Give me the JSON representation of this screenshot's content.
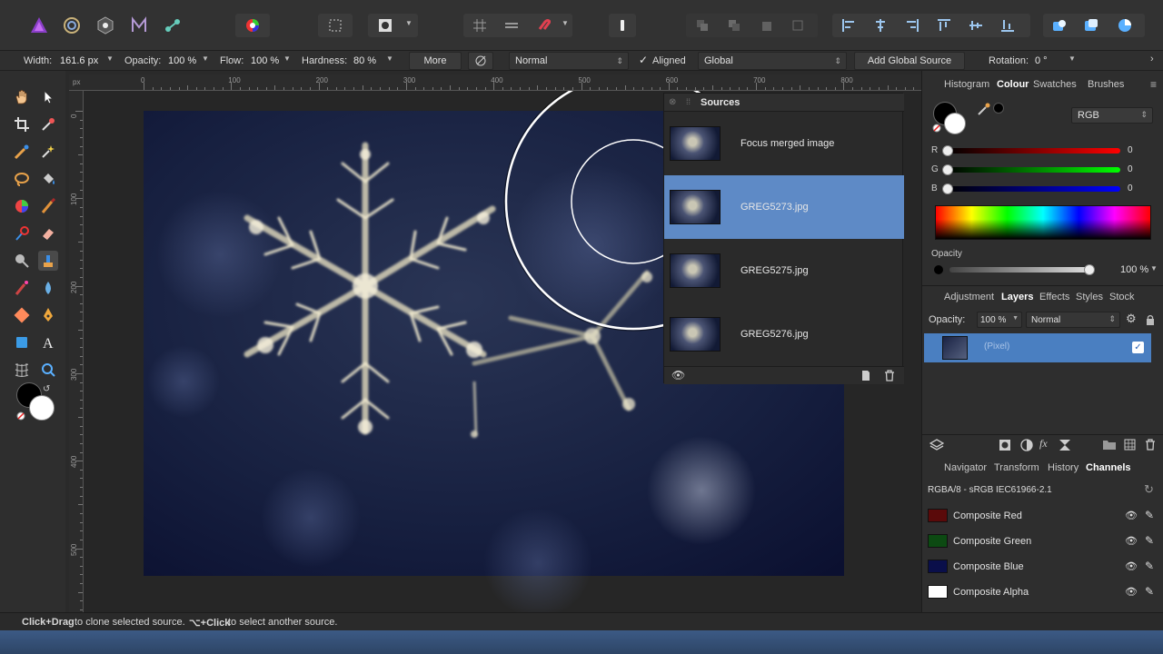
{
  "context_bar": {
    "width_label": "Width:",
    "width_value": "161.6 px",
    "opacity_label": "Opacity:",
    "opacity_value": "100 %",
    "flow_label": "Flow:",
    "flow_value": "100 %",
    "hardness_label": "Hardness:",
    "hardness_value": "80 %",
    "more_label": "More",
    "blend_mode": "Normal",
    "aligned_label": "Aligned",
    "aligned_checked": true,
    "source_mode": "Global",
    "add_source_label": "Add Global Source",
    "rotation_label": "Rotation:",
    "rotation_value": "0 °"
  },
  "rulers": {
    "unit": "px",
    "h_ticks": [
      "0",
      "100",
      "200",
      "300",
      "400",
      "500",
      "600",
      "700",
      "800"
    ],
    "v_ticks": [
      "0",
      "100",
      "200",
      "300",
      "400",
      "500"
    ]
  },
  "sources_panel": {
    "title": "Sources",
    "items": [
      {
        "label": "Focus merged image",
        "selected": false
      },
      {
        "label": "GREG5273.jpg",
        "selected": true
      },
      {
        "label": "GREG5275.jpg",
        "selected": false
      },
      {
        "label": "GREG5276.jpg",
        "selected": false
      }
    ]
  },
  "colour_panel": {
    "tabs": [
      "Histogram",
      "Colour",
      "Swatches",
      "Brushes"
    ],
    "active_tab": "Colour",
    "model": "RGB",
    "r_label": "R",
    "r_value": "0",
    "g_label": "G",
    "g_value": "0",
    "b_label": "B",
    "b_value": "0",
    "opacity_label": "Opacity",
    "opacity_value": "100 %"
  },
  "layers_panel": {
    "tabs": [
      "Adjustment",
      "Layers",
      "Effects",
      "Styles",
      "Stock"
    ],
    "active_tab": "Layers",
    "opacity_label": "Opacity:",
    "opacity_value": "100 %",
    "blend_mode": "Normal",
    "layer_name": "(Pixel)"
  },
  "channels_panel": {
    "tabs": [
      "Navigator",
      "Transform",
      "History",
      "Channels"
    ],
    "active_tab": "Channels",
    "profile": "RGBA/8 - sRGB IEC61966-2.1",
    "channels": [
      {
        "name": "Composite Red",
        "color": "#5a0a0a"
      },
      {
        "name": "Composite Green",
        "color": "#0c4a12"
      },
      {
        "name": "Composite Blue",
        "color": "#0a0f4a"
      },
      {
        "name": "Composite Alpha",
        "color": "#ffffff"
      }
    ]
  },
  "status_bar": {
    "key1": "Click+Drag",
    "text1": " to clone selected source. ",
    "key2": "⌥+Click",
    "text2": " to select another source."
  },
  "colors": {
    "selection_blue": "#5e8ac6",
    "layer_blue": "#4a7fc1",
    "panel_bg": "#2e2e2e",
    "canvas_bg": "#262626"
  },
  "icons": [
    "affinity-photo-logo",
    "develop-persona-icon",
    "liquify-persona-icon",
    "tone-map-persona-icon",
    "export-persona-icon",
    "color-wheel-icon",
    "marquee-icon",
    "mask-icon",
    "snapping-icon",
    "assistant-icon",
    "arrange-icons",
    "align-icons",
    "studio-icons"
  ]
}
